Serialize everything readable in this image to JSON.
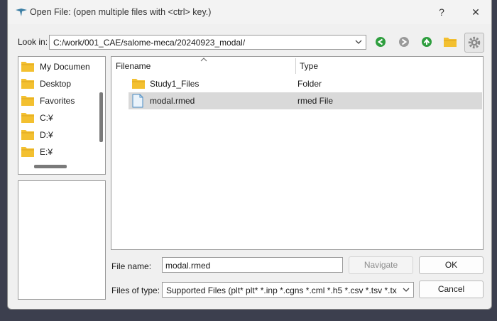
{
  "window": {
    "title": "Open File:  (open multiple files with <ctrl> key.)",
    "help_label": "?",
    "close_label": "✕"
  },
  "lookin": {
    "label": "Look in:",
    "path": "C:/work/001_CAE/salome-meca/20240923_modal/"
  },
  "nav_icons": [
    "back-icon",
    "forward-icon",
    "up-icon",
    "new-folder-icon",
    "settings-icon"
  ],
  "places": [
    {
      "label": "My Documen"
    },
    {
      "label": "Desktop"
    },
    {
      "label": "Favorites"
    },
    {
      "label": "C:¥"
    },
    {
      "label": "D:¥"
    },
    {
      "label": "E:¥"
    }
  ],
  "file_list": {
    "headers": {
      "name": "Filename",
      "type": "Type"
    },
    "rows": [
      {
        "name": "Study1_Files",
        "type": "Folder",
        "icon": "folder-icon",
        "selected": false
      },
      {
        "name": "modal.rmed",
        "type": "rmed File",
        "icon": "file-icon",
        "selected": true
      }
    ]
  },
  "filename": {
    "label": "File name:",
    "value": "modal.rmed"
  },
  "filetype": {
    "label": "Files of type:",
    "value": "Supported Files (plt* plt* *.inp *.cgns *.cml *.h5 *.csv *.tsv *.tx"
  },
  "buttons": {
    "navigate": "Navigate",
    "ok": "OK",
    "cancel": "Cancel"
  },
  "colors": {
    "accent_green": "#2e9e3e",
    "folder_yellow": "#f3c030",
    "selection": "#d9d9d9"
  }
}
